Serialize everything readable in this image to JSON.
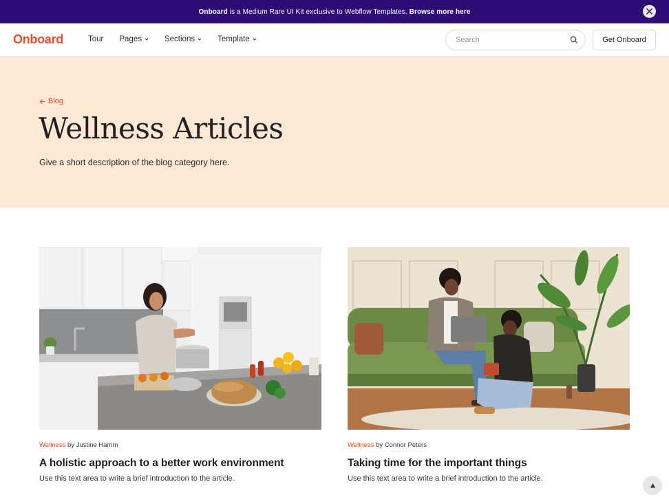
{
  "announcement": {
    "brand": "Onboard",
    "text_mid": " is a Medium Rare UI Kit exclusive to Webflow Templates. ",
    "link": "Browse more here",
    "close_icon": "close-icon"
  },
  "nav": {
    "logo": "Onboard",
    "links": [
      {
        "label": "Tour",
        "has_dropdown": false
      },
      {
        "label": "Pages",
        "has_dropdown": true
      },
      {
        "label": "Sections",
        "has_dropdown": true
      },
      {
        "label": "Template",
        "has_dropdown": true
      }
    ],
    "search": {
      "placeholder": "Search",
      "value": "",
      "icon": "search-icon"
    },
    "cta": "Get Onboard"
  },
  "hero": {
    "back_link": "Blog",
    "title": "Wellness Articles",
    "description": "Give a short description of the blog category here."
  },
  "articles": [
    {
      "category": "Wellness",
      "by": " by ",
      "author": "Justine Hamm",
      "title": "A holistic approach to a better work environment",
      "excerpt": "Use this text area to write a brief introduction to the article."
    },
    {
      "category": "Wellness",
      "by": " by ",
      "author": "Connor Peters",
      "title": "Taking time for the important things",
      "excerpt": "Use this text area to write a brief introduction to the article."
    }
  ],
  "colors": {
    "announce_bg": "#2d0c75",
    "brand": "#ef4e2b",
    "accent": "#e8492a",
    "hero_bg": "#fde8d6"
  },
  "scroll_top_icon": "arrow-up-icon"
}
